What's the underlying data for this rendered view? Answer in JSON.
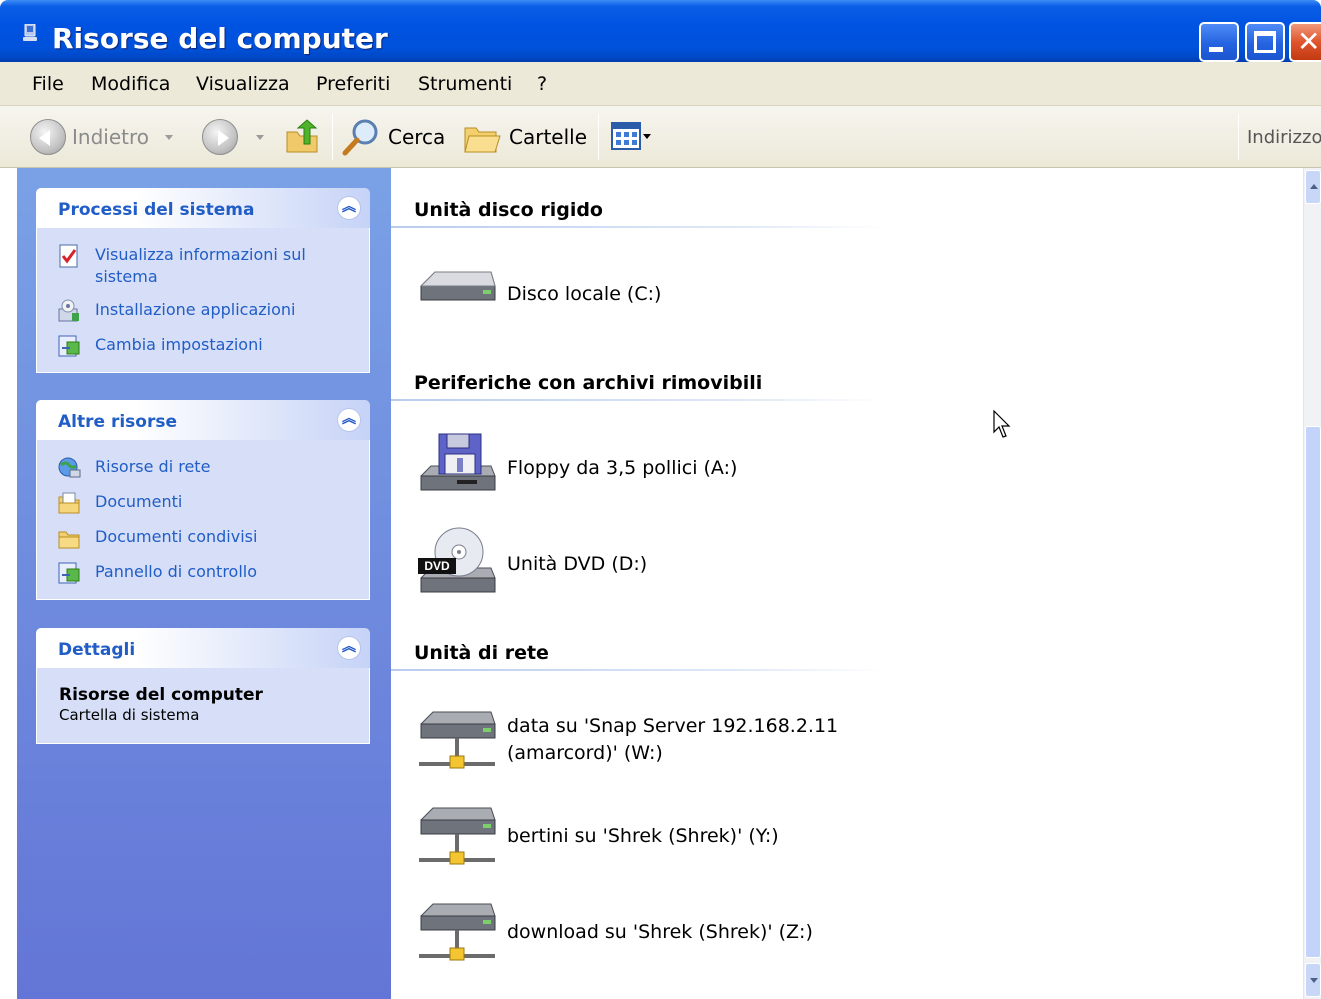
{
  "window": {
    "title": "Risorse del computer",
    "title_color": "#ffffff",
    "titlebar_color": "#0054e3",
    "close_glyph": "✕"
  },
  "menu": {
    "items": [
      "File",
      "Modifica",
      "Visualizza",
      "Preferiti",
      "Strumenti",
      "?"
    ]
  },
  "toolbar": {
    "back_label": "Indietro",
    "search_label": "Cerca",
    "folders_label": "Cartelle",
    "address_label": "Indirizzo"
  },
  "sidebar": {
    "system_tasks": {
      "title": "Processi del sistema",
      "collapse_glyph": "︽",
      "items": [
        {
          "label": "Visualizza informazioni sul sistema",
          "icon": "system-info-icon"
        },
        {
          "label": "Installazione applicazioni",
          "icon": "add-remove-programs-icon"
        },
        {
          "label": "Cambia impostazioni",
          "icon": "control-panel-icon"
        }
      ]
    },
    "other_places": {
      "title": "Altre risorse",
      "collapse_glyph": "︽",
      "items": [
        {
          "label": "Risorse di rete",
          "icon": "network-places-icon"
        },
        {
          "label": "Documenti",
          "icon": "my-documents-icon"
        },
        {
          "label": "Documenti condivisi",
          "icon": "shared-documents-folder-icon"
        },
        {
          "label": "Pannello di controllo",
          "icon": "control-panel-icon"
        }
      ]
    },
    "details": {
      "title": "Dettagli",
      "collapse_glyph": "︽",
      "name": "Risorse del computer",
      "type": "Cartella di sistema"
    }
  },
  "main": {
    "groups": [
      {
        "title": "Unità disco rigido",
        "items": [
          {
            "label": "Disco locale (C:)",
            "icon": "hard-disk-icon"
          }
        ]
      },
      {
        "title": "Periferiche con archivi rimovibili",
        "items": [
          {
            "label": "Floppy da 3,5 pollici (A:)",
            "icon": "floppy-drive-icon"
          },
          {
            "label": "Unità DVD (D:)",
            "icon": "dvd-drive-icon",
            "badge": "DVD"
          }
        ]
      },
      {
        "title": "Unità di rete",
        "items": [
          {
            "label": "data su 'Snap Server 192.168.2.11\n(amarcord)' (W:)",
            "icon": "network-drive-icon"
          },
          {
            "label": "bertini su 'Shrek (Shrek)' (Y:)",
            "icon": "network-drive-icon"
          },
          {
            "label": "download su 'Shrek (Shrek)' (Z:)",
            "icon": "network-drive-icon"
          }
        ]
      }
    ]
  },
  "colors": {
    "sidebar_gradient_top": "#7aa1e6",
    "sidebar_gradient_bottom": "#6375d6",
    "task_link": "#215dc6",
    "menubar_bg": "#ece9d8"
  }
}
